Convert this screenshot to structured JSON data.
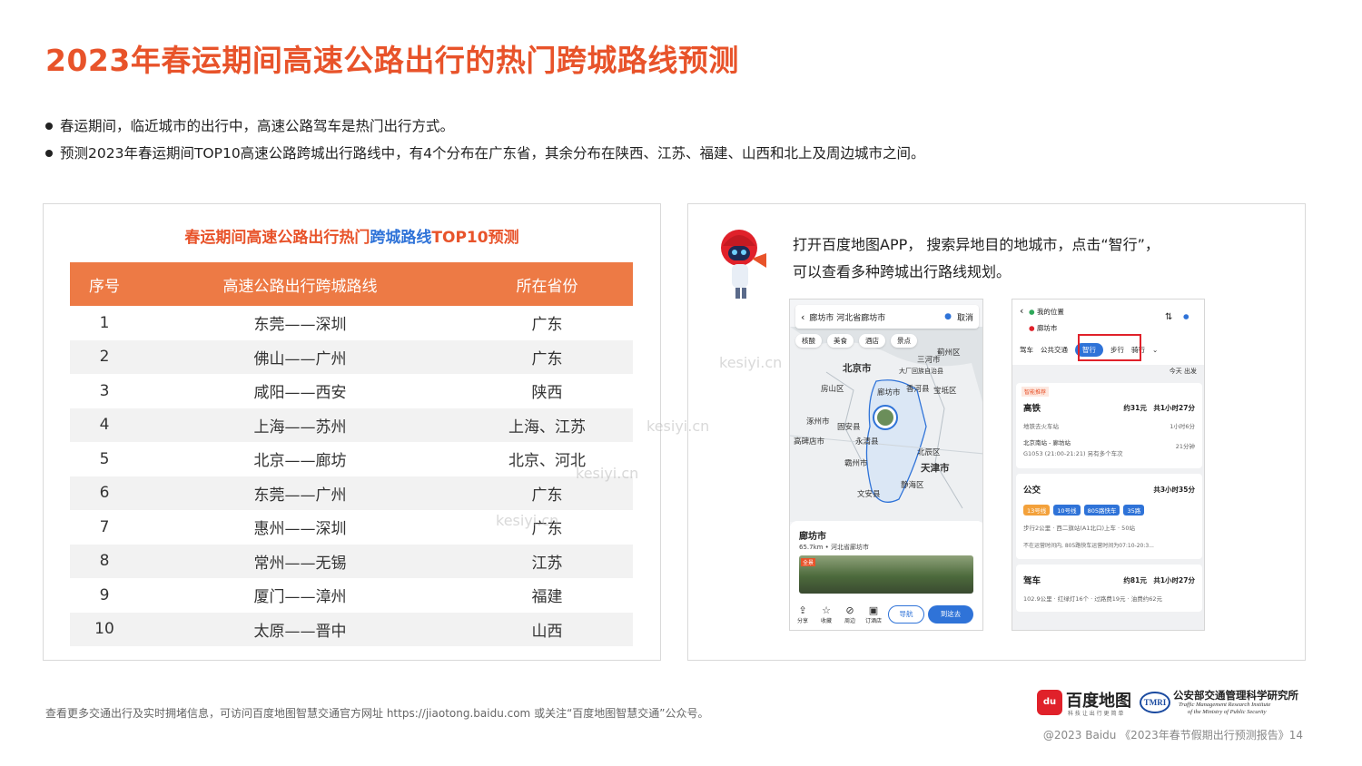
{
  "page": {
    "title": "2023年春运期间高速公路出行的热门跨城路线预测",
    "bullets": [
      "春运期间，临近城市的出行中，高速公路驾车是热门出行方式。",
      "预测2023年春运期间TOP10高速公路跨城出行路线中，有4个分布在广东省，其余分布在陕西、江苏、福建、山西和北上及周边城市之间。"
    ]
  },
  "table": {
    "title_part1": "春运期间高速公路出行热门",
    "title_highlight": "跨城路线",
    "title_part2": "TOP10预测",
    "headers": [
      "序号",
      "高速公路出行跨城路线",
      "所在省份"
    ],
    "rows": [
      [
        "1",
        "东莞——深圳",
        "广东"
      ],
      [
        "2",
        "佛山——广州",
        "广东"
      ],
      [
        "3",
        "咸阳——西安",
        "陕西"
      ],
      [
        "4",
        "上海——苏州",
        "上海、江苏"
      ],
      [
        "5",
        "北京——廊坊",
        "北京、河北"
      ],
      [
        "6",
        "东莞——广州",
        "广东"
      ],
      [
        "7",
        "惠州——深圳",
        "广东"
      ],
      [
        "8",
        "常州——无锡",
        "江苏"
      ],
      [
        "9",
        "厦门——漳州",
        "福建"
      ],
      [
        "10",
        "太原——晋中",
        "山西"
      ]
    ]
  },
  "instruction": {
    "line1": "打开百度地图APP， 搜索异地目的地城市，点击“智行”，",
    "line2": "可以查看多种跨城出行路线规划。"
  },
  "phone1": {
    "search_text": "廊坊市 河北省廊坊市",
    "cancel": "取消",
    "chips": [
      "核酸",
      "美食",
      "酒店",
      "景点"
    ],
    "map_labels": [
      "北京市",
      "三河市",
      "大厂回族自治县",
      "香河县",
      "宝坻区",
      "房山区",
      "廊坊市",
      "涿州市",
      "固安县",
      "永清县",
      "高碑店市",
      "霸州市",
      "北辰区",
      "天津市",
      "静海区",
      "文安县",
      "蓟州区"
    ],
    "place_title": "廊坊市",
    "place_sub": "65.7km • 河北省廊坊市",
    "photo_tag": "全景",
    "bottom_items": [
      "分享",
      "收藏",
      "周边",
      "订酒店"
    ],
    "btn_nav": "导航",
    "btn_go": "到这去"
  },
  "phone2": {
    "from": "我的位置",
    "to": "廊坊市",
    "modes": [
      "驾车",
      "公共交通",
      "智行",
      "步行",
      "骑行"
    ],
    "date": "今天 出发",
    "recommend_badge": "智能推荐",
    "rail": {
      "label": "高铁",
      "price": "约31元",
      "time": "共1小时27分",
      "step1": "地铁去火车站",
      "step1_time": "1小时6分",
      "step2": "北京南站 - 廊坊站",
      "step2_sub": "G1053 (21:00-21:21) 另有多个车次",
      "step2_time": "21分钟"
    },
    "bus": {
      "label": "公交",
      "time": "共3小时35分",
      "lines": [
        "13号线",
        "10号线",
        "805路快车",
        "35路"
      ],
      "sub1": "步行2公里 · 西二旗站(A1北口)上车 · 50站",
      "sub2": "不在运营时间内, 805路快车运营时间为07:10-20:3..."
    },
    "car": {
      "label": "驾车",
      "price": "约81元",
      "time": "共1小时27分",
      "sub": "102.9公里 · 红绿灯16个 · 过路费19元 · 油费约62元"
    }
  },
  "watermarks": [
    "kesiyi.cn",
    "kesiyi.cn",
    "kesiyi.cn",
    "kesiyi.cn"
  ],
  "footer": {
    "note": "查看更多交通出行及实时拥堵信息，可访问百度地图智慧交通官方网址 https://jiaotong.baidu.com 或关注“百度地图智慧交通”公众号。",
    "copyright": "@2023 Baidu 《2023年春节假期出行预测报告》14"
  },
  "logos": {
    "baidu_icon": "du",
    "baidu_name": "百度地图",
    "baidu_slogan": "科 技 让 出 行 更 简 单",
    "tmri_icon": "TMRI",
    "tmri_cn": "公安部交通管理科学研究所",
    "tmri_en1": "Traffic Management Research Institute",
    "tmri_en2": "of the Ministry of Public Security"
  },
  "colors": {
    "accent": "#e8532a",
    "header_bg": "#ed7a45",
    "highlight": "#2f73d8",
    "stripe": "#f2f2f2"
  }
}
